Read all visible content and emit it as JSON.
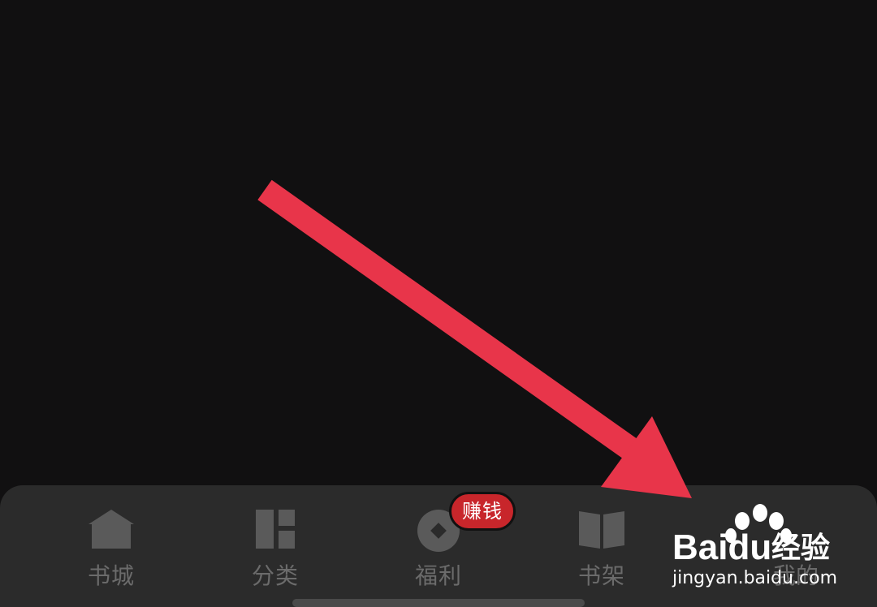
{
  "tabbar": {
    "tabs": [
      {
        "label": "书城",
        "icon": "bookstore-house-icon"
      },
      {
        "label": "分类",
        "icon": "category-grid-icon"
      },
      {
        "label": "福利",
        "icon": "welfare-coin-icon"
      },
      {
        "label": "书架",
        "icon": "bookshelf-open-book-icon"
      },
      {
        "label": "我的",
        "icon": "profile-icon"
      }
    ],
    "badge": "赚钱"
  },
  "annotation": {
    "type": "arrow",
    "color": "#e8354a",
    "points_to": "我的"
  },
  "watermark": {
    "brand_prefix": "Bai",
    "brand_suffix": "du",
    "brand_cn": "经验",
    "url": "jingyan.baidu.com"
  },
  "colors": {
    "background": "#111011",
    "tabbar": "#2b2b2b",
    "tab_inactive": "#6b6b6b",
    "badge": "#c8262b",
    "arrow": "#e8354a"
  }
}
